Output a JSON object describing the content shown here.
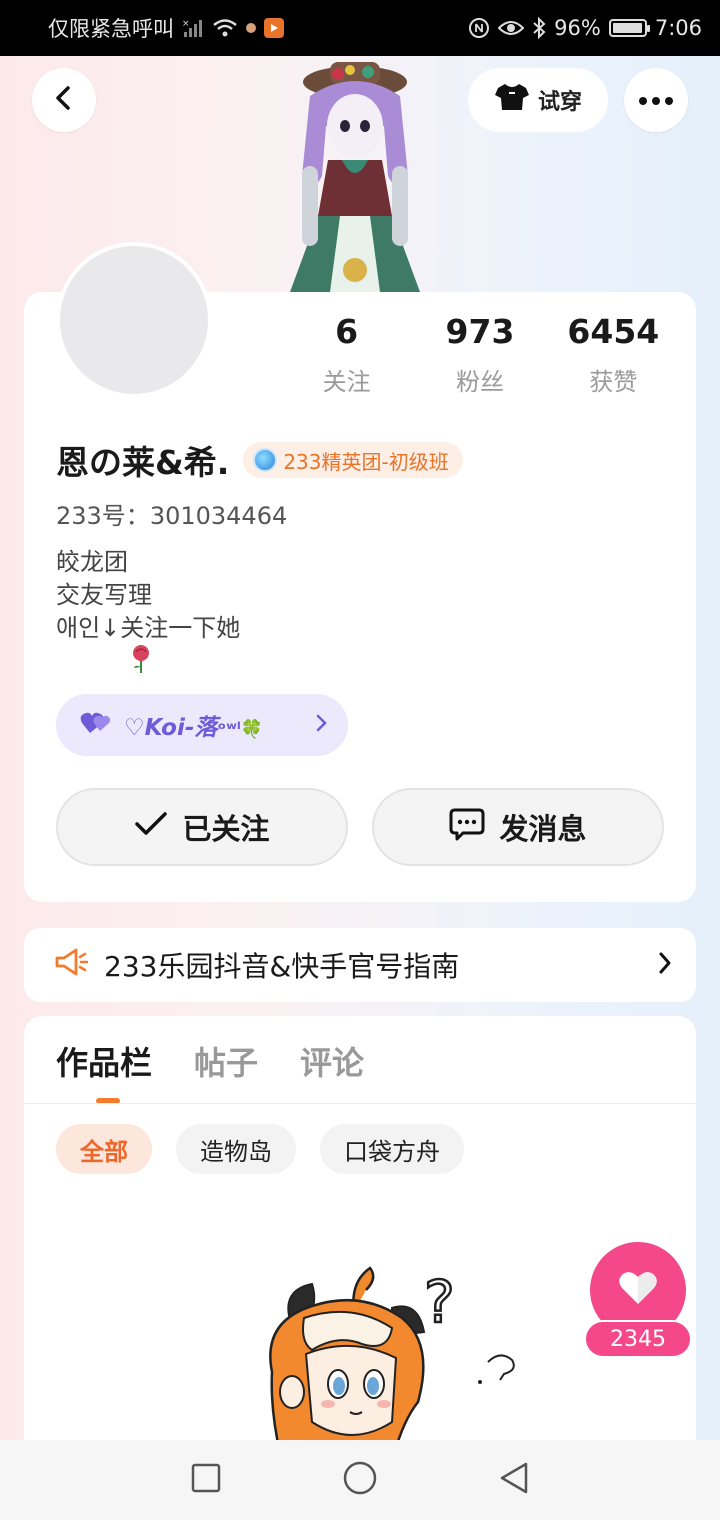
{
  "status_bar": {
    "carrier": "仅限紧急呼叫",
    "battery_percent": "96%",
    "battery_level": 0.96,
    "time": "7:06"
  },
  "header": {
    "try_on_label": "试穿"
  },
  "profile": {
    "stats": [
      {
        "value": "6",
        "label": "关注"
      },
      {
        "value": "973",
        "label": "粉丝"
      },
      {
        "value": "6454",
        "label": "获赞"
      }
    ],
    "name": "恩の莱&希.",
    "badge": "233精英团-初级班",
    "uid_label": "233号：",
    "uid": "301034464",
    "bio_lines": [
      "皎龙团",
      "交友写理",
      "애인↓关注一下她"
    ],
    "friend_chip": "♡Koi-落",
    "friend_chip_suffix": "ᵒʷˡ🍀",
    "follow_button": "已关注",
    "message_button": "发消息"
  },
  "notice": {
    "text": "233乐园抖音&快手官号指南"
  },
  "works": {
    "tabs": [
      "作品栏",
      "帖子",
      "评论"
    ],
    "chips": [
      "全部",
      "造物岛",
      "口袋方舟"
    ]
  },
  "like_fab": {
    "count": "2345"
  },
  "colors": {
    "accent_orange": "#f47a2c",
    "like_pink": "#f4488a",
    "friend_purple": "#6f5ad8"
  }
}
